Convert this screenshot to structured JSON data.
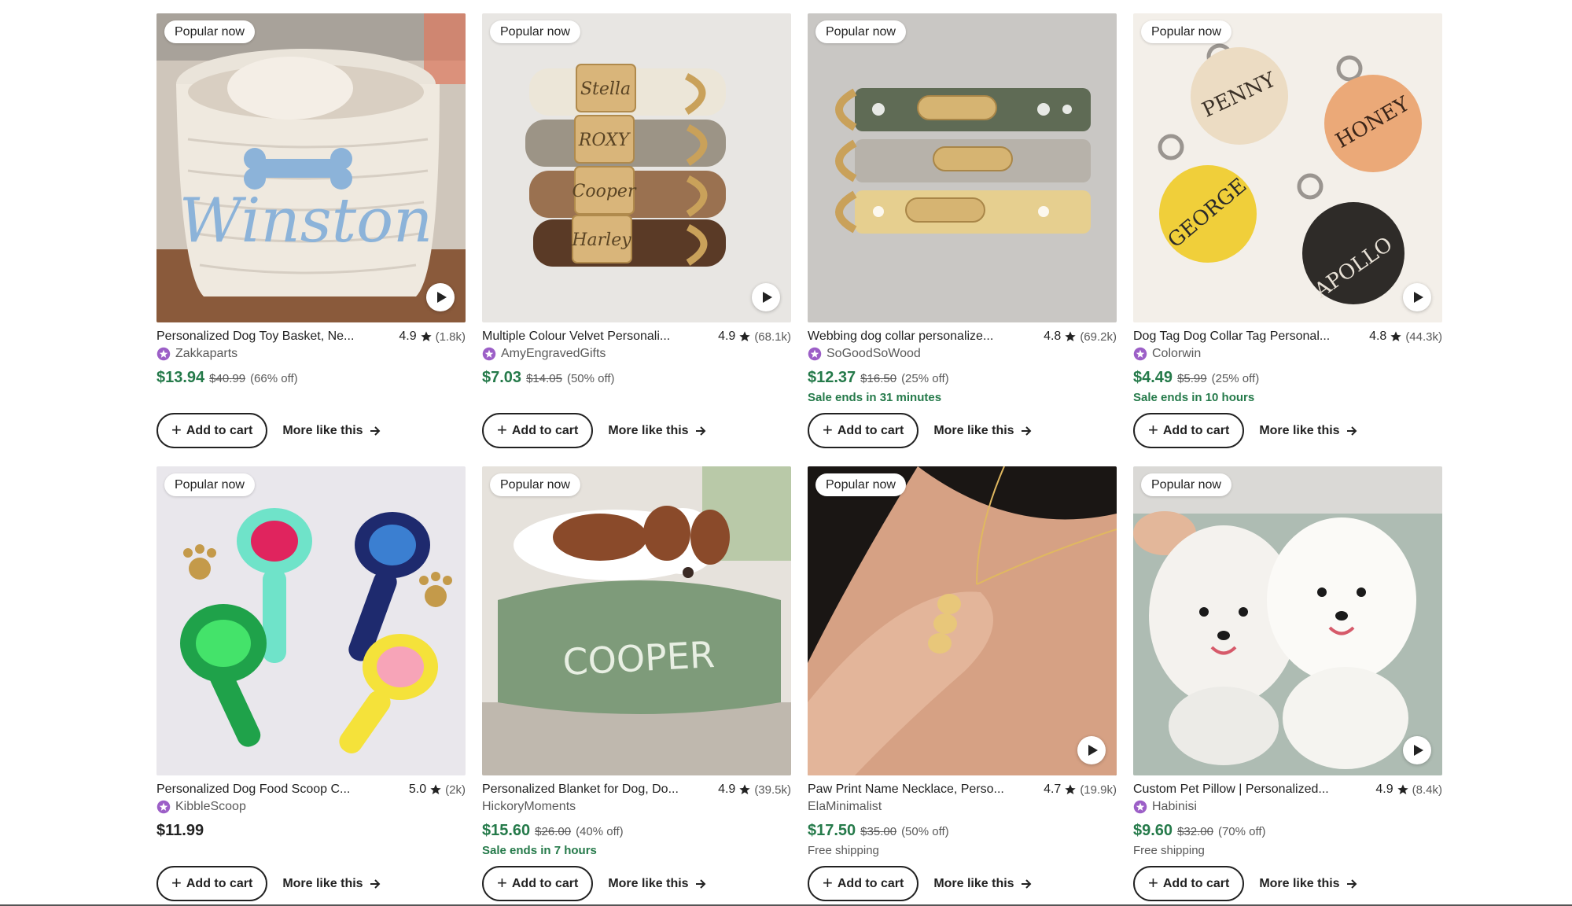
{
  "badge_label": "Popular now",
  "cart_label": "Add to cart",
  "more_label": "More like this",
  "colors": {
    "sale_green": "#257a4a",
    "seller_badge": "#9c5fc7"
  },
  "products": [
    {
      "title": "Personalized Dog Toy Basket, Ne...",
      "rating": "4.9",
      "reviews": "(1.8k)",
      "shop": "Zakkaparts",
      "star_seller": true,
      "price": "$13.94",
      "original": "$40.99",
      "discount": "(66% off)",
      "note": "",
      "video": true
    },
    {
      "title": "Multiple Colour Velvet Personali...",
      "rating": "4.9",
      "reviews": "(68.1k)",
      "shop": "AmyEngravedGifts",
      "star_seller": true,
      "price": "$7.03",
      "original": "$14.05",
      "discount": "(50% off)",
      "note": "",
      "video": true
    },
    {
      "title": "Webbing dog collar personalize...",
      "rating": "4.8",
      "reviews": "(69.2k)",
      "shop": "SoGoodSoWood",
      "star_seller": true,
      "price": "$12.37",
      "original": "$16.50",
      "discount": "(25% off)",
      "note": "Sale ends in 31 minutes",
      "video": false
    },
    {
      "title": "Dog Tag Dog Collar Tag Personal...",
      "rating": "4.8",
      "reviews": "(44.3k)",
      "shop": "Colorwin",
      "star_seller": true,
      "price": "$4.49",
      "original": "$5.99",
      "discount": "(25% off)",
      "note": "Sale ends in 10 hours",
      "video": true
    },
    {
      "title": "Personalized Dog Food Scoop C...",
      "rating": "5.0",
      "reviews": "(2k)",
      "shop": "KibbleScoop",
      "star_seller": true,
      "price": "$11.99",
      "original": "",
      "discount": "",
      "note": "",
      "video": false
    },
    {
      "title": "Personalized Blanket for Dog, Do...",
      "rating": "4.9",
      "reviews": "(39.5k)",
      "shop": "HickoryMoments",
      "star_seller": false,
      "price": "$15.60",
      "original": "$26.00",
      "discount": "(40% off)",
      "note": "Sale ends in 7 hours",
      "video": false
    },
    {
      "title": "Paw Print Name Necklace, Perso...",
      "rating": "4.7",
      "reviews": "(19.9k)",
      "shop": "ElaMinimalist",
      "star_seller": false,
      "price": "$17.50",
      "original": "$35.00",
      "discount": "(50% off)",
      "note": "Free shipping",
      "video": true
    },
    {
      "title": "Custom Pet Pillow | Personalized...",
      "rating": "4.9",
      "reviews": "(8.4k)",
      "shop": "Habinisi",
      "star_seller": true,
      "price": "$9.60",
      "original": "$32.00",
      "discount": "(70% off)",
      "note": "Free shipping",
      "video": true
    }
  ],
  "image_text": {
    "basket": "Winston",
    "collar_1": "Stella",
    "collar_2": "ROXY",
    "collar_3": "Cooper",
    "collar_4": "Harley",
    "tag_1": "PENNY",
    "tag_2": "HONEY",
    "tag_3": "GEORGE",
    "tag_4": "APOLLO",
    "blanket": "COOPER"
  }
}
